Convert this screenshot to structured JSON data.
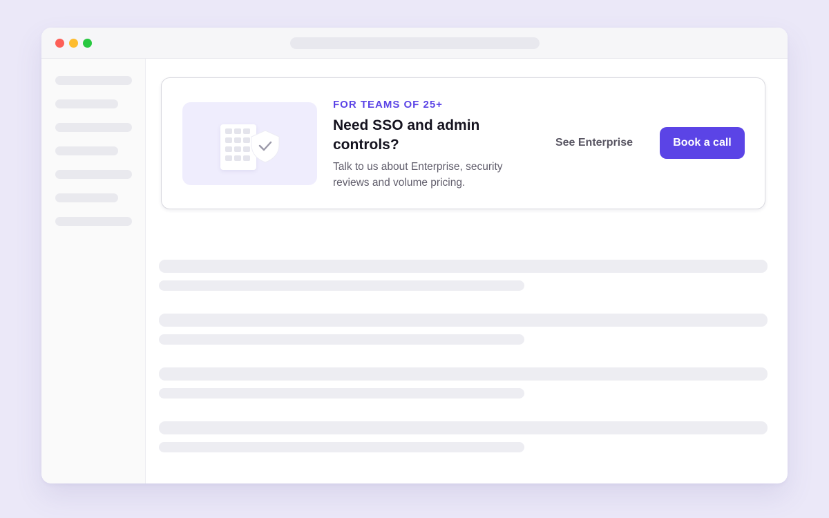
{
  "colors": {
    "accent": "#5b44e6",
    "page_background": "#ebe8f8",
    "illustration_tint": "#efedfd",
    "traffic_red": "#fd5f57",
    "traffic_yellow": "#febc2e",
    "traffic_green": "#28c840"
  },
  "window": {
    "controls": [
      "close",
      "minimize",
      "zoom"
    ]
  },
  "banner": {
    "illustration": {
      "icons": [
        "building-icon",
        "shield-check-icon"
      ]
    },
    "eyebrow": "FOR TEAMS OF 25+",
    "headline": "Need SSO and admin controls?",
    "description": "Talk to us about Enterprise, security reviews and volume pricing.",
    "secondary_action": "See Enterprise",
    "primary_action": "Book a call"
  }
}
